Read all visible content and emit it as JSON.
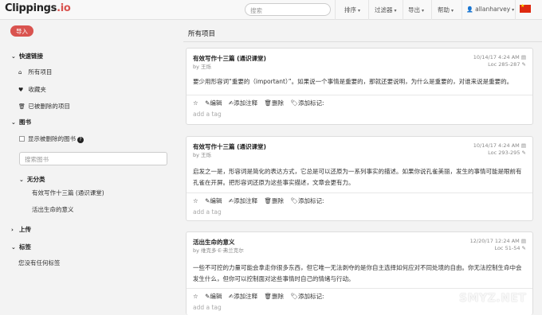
{
  "brand": {
    "name": "Clippings",
    "tld": ".io"
  },
  "search": {
    "placeholder": "搜索"
  },
  "nav": {
    "sort": "排序",
    "filter": "过滤器",
    "export": "导出",
    "help": "帮助",
    "user": "allanharvey"
  },
  "sidebar": {
    "import_label": "导入",
    "quicklinks_label": "快速链接",
    "quicklinks": [
      {
        "label": "所有项目",
        "icon": "home-icon"
      },
      {
        "label": "收藏夹",
        "icon": "heart-icon"
      },
      {
        "label": "已被删除的项目",
        "icon": "trash-icon"
      }
    ],
    "books_label": "图书",
    "show_deleted_label": "显示被删除的图书",
    "book_search_placeholder": "搜索图书",
    "uncategorized_label": "无分类",
    "books": [
      "有效写作十三篇 (通识课堂)",
      "活出生命的意义"
    ],
    "upload_label": "上传",
    "tags_label": "标签",
    "no_tags_label": "您没有任何标签"
  },
  "main": {
    "title": "所有项目",
    "actions": {
      "edit": "编辑",
      "add_note": "添加注释",
      "delete": "删除",
      "add_tag": "添加标记:"
    },
    "tag_placeholder": "add a tag",
    "clippings": [
      {
        "title": "有效写作十三篇 (通识课堂)",
        "author": "by 王烁",
        "date": "10/14/17 4:24 AM",
        "loc": "Loc 285-287",
        "body": "要少用形容词“重要的（important）”。如果说一个事情是重要的，那就还要说明，为什么是重要的，对谁来说是重要的。"
      },
      {
        "title": "有效写作十三篇 (通识课堂)",
        "author": "by 王烁",
        "date": "10/14/17 4:24 AM",
        "loc": "Loc 293-295",
        "body": "启发之一是，形容词是简化的表达方式，它总是可以还原为一系列事实的描述。如果你说孔雀美丽，发生的事情可能是眼前有孔雀在开屏。把形容词还原为这些事实描述，文章会更有力。"
      },
      {
        "title": "活出生命的意义",
        "author": "by 维克多·E·弗兰克尔",
        "date": "12/20/17 12:24 AM",
        "loc": "Loc 51-54",
        "body": "一些不可控的力量可能会拿走你很多东西，但它唯一无法剥夺的是你自主选择如何应对不同处境的自由。你无法控制生命中会发生什么，但你可以控制面对这些事情时自己的情绪与行动。"
      }
    ]
  },
  "watermark": "SMYZ.NET"
}
